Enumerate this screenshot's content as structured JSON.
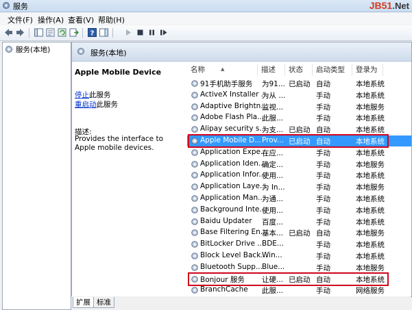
{
  "window": {
    "title": "服务"
  },
  "watermark": {
    "brand": "JB51",
    "dot": ".",
    "suffix": "Net"
  },
  "menu": [
    "文件(F)",
    "操作(A)",
    "查看(V)",
    "帮助(H)"
  ],
  "tree": {
    "root_label": "服务(本地)"
  },
  "panel": {
    "header": "服务(本地)"
  },
  "detail": {
    "service_name": "Apple Mobile Device",
    "stop_link": "停止",
    "stop_rest": "此服务",
    "restart_link": "重启动",
    "restart_rest": "此服务",
    "desc_label": "描述:",
    "desc_text": "Provides the interface to Apple mobile devices."
  },
  "columns": [
    "名称",
    "描述",
    "状态",
    "启动类型",
    "登录为"
  ],
  "services": [
    {
      "name": "91手机助手服务",
      "desc": "为91...",
      "status": "已启动",
      "startup": "自动",
      "logon": "本地系统"
    },
    {
      "name": "ActiveX Installer ...",
      "desc": "为从 ...",
      "status": "",
      "startup": "手动",
      "logon": "本地系统"
    },
    {
      "name": "Adaptive Brightn...",
      "desc": "监视...",
      "status": "",
      "startup": "手动",
      "logon": "本地服务"
    },
    {
      "name": "Adobe Flash Pla...",
      "desc": "此服...",
      "status": "",
      "startup": "手动",
      "logon": "本地系统"
    },
    {
      "name": "Alipay security s...",
      "desc": "为支...",
      "status": "已启动",
      "startup": "自动",
      "logon": "本地系统"
    },
    {
      "name": "Apple Mobile D...",
      "desc": "Prov...",
      "status": "已启动",
      "startup": "自动",
      "logon": "本地系统"
    },
    {
      "name": "Application Expe...",
      "desc": "在应...",
      "status": "",
      "startup": "手动",
      "logon": "本地系统"
    },
    {
      "name": "Application Iden...",
      "desc": "确定...",
      "status": "",
      "startup": "手动",
      "logon": "本地服务"
    },
    {
      "name": "Application Infor...",
      "desc": "使用...",
      "status": "",
      "startup": "手动",
      "logon": "本地系统"
    },
    {
      "name": "Application Laye...",
      "desc": "为 In...",
      "status": "",
      "startup": "手动",
      "logon": "本地服务"
    },
    {
      "name": "Application Man...",
      "desc": "为通...",
      "status": "",
      "startup": "手动",
      "logon": "本地系统"
    },
    {
      "name": "Background Inte...",
      "desc": "使用...",
      "status": "",
      "startup": "手动",
      "logon": "本地系统"
    },
    {
      "name": "Baidu Updater",
      "desc": "百度...",
      "status": "",
      "startup": "手动",
      "logon": "本地系统"
    },
    {
      "name": "Base Filtering En...",
      "desc": "基本...",
      "status": "已启动",
      "startup": "自动",
      "logon": "本地服务"
    },
    {
      "name": "BitLocker Drive ...",
      "desc": "BDE...",
      "status": "",
      "startup": "手动",
      "logon": "本地系统"
    },
    {
      "name": "Block Level Back...",
      "desc": "Win...",
      "status": "",
      "startup": "手动",
      "logon": "本地系统"
    },
    {
      "name": "Bluetooth Supp...",
      "desc": "Blue...",
      "status": "",
      "startup": "手动",
      "logon": "本地服务"
    },
    {
      "name": "Bonjour 服务",
      "desc": "让硬...",
      "status": "已启动",
      "startup": "自动",
      "logon": "本地系统"
    },
    {
      "name": "BranchCache",
      "desc": "此服...",
      "status": "",
      "startup": "手动",
      "logon": "网络服务"
    }
  ],
  "tabs": [
    "扩展",
    "标准"
  ],
  "colors": {
    "selection": "#3399ff",
    "highlight_box": "#d0021b",
    "link": "#0033cc"
  }
}
